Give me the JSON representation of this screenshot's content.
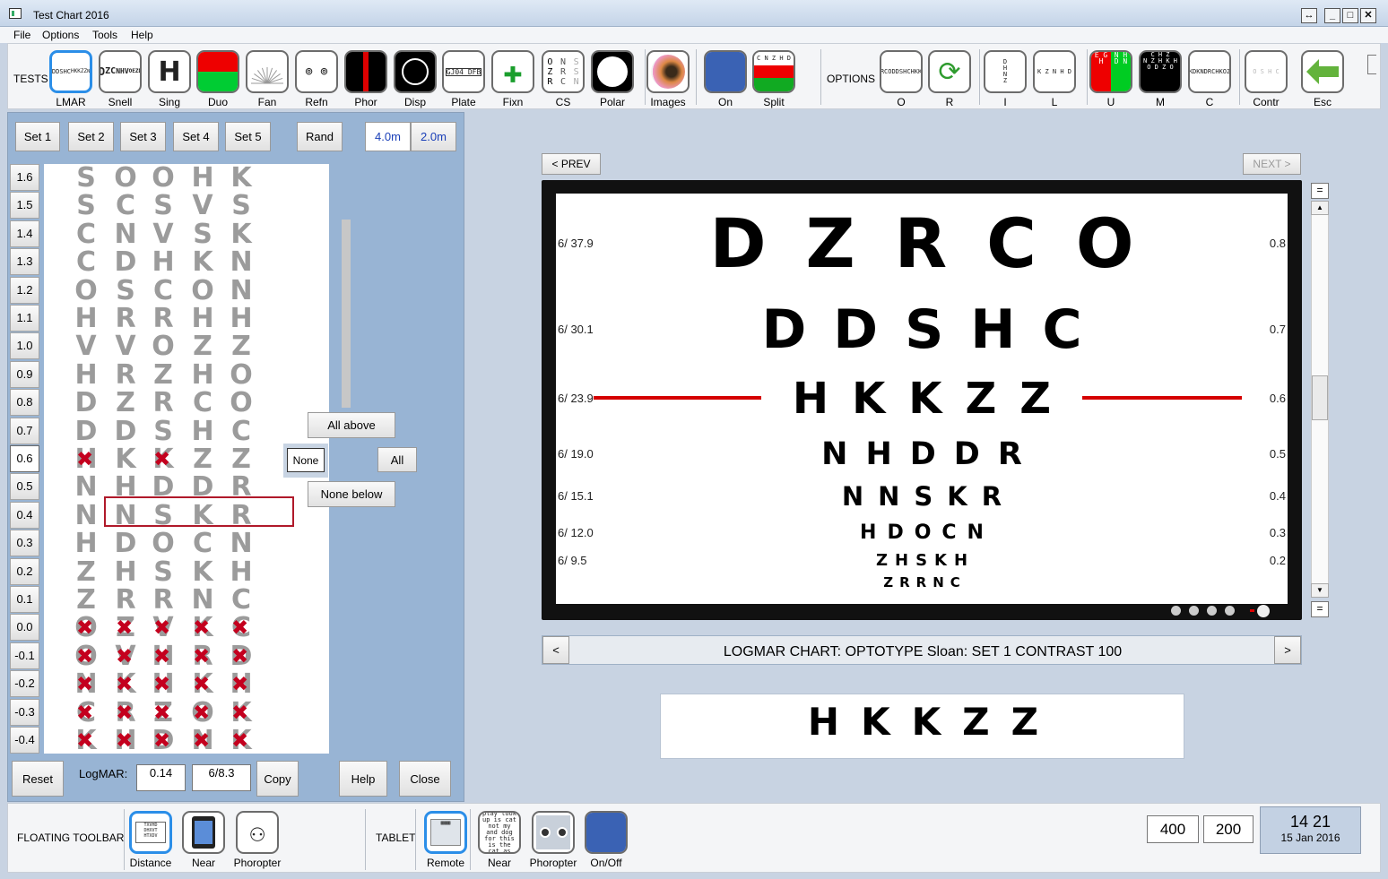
{
  "window": {
    "title": "Test Chart 2016"
  },
  "menu": [
    "File",
    "Options",
    "Tools",
    "Help"
  ],
  "toolbar": {
    "tests_label": "TESTS",
    "options_label": "OPTIONS",
    "tests": [
      {
        "id": "lmar",
        "label": "LMAR",
        "icon": "logmar-chart-icon",
        "selected": true
      },
      {
        "id": "snell",
        "label": "Snell",
        "icon": "snellen-chart-icon"
      },
      {
        "id": "sing",
        "label": "Sing",
        "icon": "single-letter-icon"
      },
      {
        "id": "duo",
        "label": "Duo",
        "icon": "duochrome-icon"
      },
      {
        "id": "fan",
        "label": "Fan",
        "icon": "fan-chart-icon"
      },
      {
        "id": "refn",
        "label": "Refn",
        "icon": "refraction-icon"
      },
      {
        "id": "phor",
        "label": "Phor",
        "icon": "phoria-icon"
      },
      {
        "id": "disp",
        "label": "Disp",
        "icon": "disparity-icon"
      },
      {
        "id": "plate",
        "label": "Plate",
        "icon": "plate-icon"
      },
      {
        "id": "fixn",
        "label": "Fixn",
        "icon": "fixation-cross-icon"
      },
      {
        "id": "cs",
        "label": "CS",
        "icon": "contrast-sensitivity-icon"
      },
      {
        "id": "polar",
        "label": "Polar",
        "icon": "polar-icon"
      },
      {
        "id": "images",
        "label": "Images",
        "icon": "eye-image-icon"
      },
      {
        "id": "on",
        "label": "On",
        "icon": "display-on-icon"
      },
      {
        "id": "split",
        "label": "Split",
        "icon": "split-icon"
      }
    ],
    "options": [
      {
        "id": "o",
        "label": "O",
        "icon": "optotype-icon"
      },
      {
        "id": "r",
        "label": "R",
        "icon": "rotate-icon"
      },
      {
        "id": "i",
        "label": "I",
        "icon": "vertical-letters-icon"
      },
      {
        "id": "l",
        "label": "L",
        "icon": "line-letters-icon"
      },
      {
        "id": "u",
        "label": "U",
        "icon": "red-green-chart-icon"
      },
      {
        "id": "m",
        "label": "M",
        "icon": "mirror-chart-icon"
      },
      {
        "id": "c",
        "label": "C",
        "icon": "chart-c-icon"
      },
      {
        "id": "contr",
        "label": "Contr",
        "icon": "contrast-icon"
      },
      {
        "id": "esc",
        "label": "Esc",
        "icon": "back-arrow-icon"
      }
    ],
    "icon_text": {
      "lmar": [
        "DZRCO",
        "DDSHC",
        "HKKZZ",
        "NHDDR",
        "NNSKR"
      ],
      "snell": [
        "D",
        "ZC",
        "NHV",
        "OEZD"
      ],
      "sing": "H",
      "plate": "GJ04 DFB",
      "cs": [
        "O Z R",
        "N R C",
        "S S N"
      ],
      "split": "C N Z H D",
      "o": [
        "DZRCO",
        "DDSHC",
        "HKKZZ"
      ],
      "i": "D H N Z",
      "l": "K Z N H D",
      "u": [
        "E G H",
        "N H D N"
      ],
      "m": [
        "C H Z",
        "N Z H K H",
        "O D Z O"
      ],
      "c": [
        "SVKDK",
        "NDRCH",
        "KOZCN"
      ],
      "contr": "O S H C"
    }
  },
  "panel": {
    "sets": [
      "Set 1",
      "Set 2",
      "Set 3",
      "Set 4",
      "Set 5"
    ],
    "rand": "Rand",
    "dist": [
      "4.0m",
      "2.0m"
    ],
    "rows": [
      {
        "v": "1.6",
        "l": "SOOHK"
      },
      {
        "v": "1.5",
        "l": "SCSVS"
      },
      {
        "v": "1.4",
        "l": "CNVSK"
      },
      {
        "v": "1.3",
        "l": "CDHKN"
      },
      {
        "v": "1.2",
        "l": "OSCON"
      },
      {
        "v": "1.1",
        "l": "HRRHH"
      },
      {
        "v": "1.0",
        "l": "VVOZZ"
      },
      {
        "v": "0.9",
        "l": "HRZHO"
      },
      {
        "v": "0.8",
        "l": "DZRCO"
      },
      {
        "v": "0.7",
        "l": "DDSHC"
      },
      {
        "v": "0.6",
        "l": "HKKZZ",
        "x": [
          0,
          2
        ]
      },
      {
        "v": "0.5",
        "l": "NHDDR"
      },
      {
        "v": "0.4",
        "l": "NNSKR"
      },
      {
        "v": "0.3",
        "l": "HDOCN"
      },
      {
        "v": "0.2",
        "l": "ZHSKH"
      },
      {
        "v": "0.1",
        "l": "ZRRNC"
      },
      {
        "v": "0.0",
        "l": "OZVKC",
        "x": [
          0,
          1,
          2,
          3,
          4
        ]
      },
      {
        "v": "-0.1",
        "l": "OVHRD",
        "x": [
          0,
          1,
          2,
          3,
          4
        ]
      },
      {
        "v": "-0.2",
        "l": "NKHKH",
        "x": [
          0,
          1,
          2,
          3,
          4
        ]
      },
      {
        "v": "-0.3",
        "l": "CRZOK",
        "x": [
          0,
          1,
          2,
          3,
          4
        ]
      },
      {
        "v": "-0.4",
        "l": "KHDNK",
        "x": [
          0,
          1,
          2,
          3,
          4
        ]
      }
    ],
    "all_above": "All above",
    "none": "None",
    "all": "All",
    "none_below": "None below",
    "reset": "Reset",
    "logmar_label": "LogMAR:",
    "logmar_value": "0.14",
    "snellen_value": "6/8.3",
    "copy": "Copy",
    "help": "Help",
    "close": "Close"
  },
  "chart": {
    "prev": "< PREV",
    "next": "NEXT >",
    "rows": [
      {
        "left": "6/ 37.9",
        "right": "0.8",
        "letters": "DZRCO"
      },
      {
        "left": "6/ 30.1",
        "right": "0.7",
        "letters": "DDSHC"
      },
      {
        "left": "6/ 23.9",
        "right": "0.6",
        "letters": "HKKZZ"
      },
      {
        "left": "6/ 19.0",
        "right": "0.5",
        "letters": "NHDDR"
      },
      {
        "left": "6/ 15.1",
        "right": "0.4",
        "letters": "NNSKR"
      },
      {
        "left": "6/ 12.0",
        "right": "0.3",
        "letters": "HDOCN"
      },
      {
        "left": "6/ 9.5",
        "right": "0.2",
        "letters": "ZHSKH"
      },
      {
        "left": "",
        "right": "",
        "letters": "ZRRNC"
      }
    ],
    "status": "LOGMAR CHART:  OPTOTYPE Sloan:   SET 1  CONTRAST  100",
    "focus_line": "HKKZZ"
  },
  "bottom": {
    "floating_label": "FLOATING TOOLBAR",
    "tablet_label": "TABLET",
    "floating": [
      {
        "label": "Distance",
        "icon": "distance-chart-icon",
        "selected": true
      },
      {
        "label": "Near",
        "icon": "tablet-icon"
      },
      {
        "label": "Phoropter",
        "icon": "phoropter-icon"
      }
    ],
    "tablet": [
      {
        "label": "Remote",
        "icon": "remote-icon",
        "selected": true
      },
      {
        "label": "Near",
        "icon": "near-text-icon",
        "text": "see the play look up is cat not my and dog for this is the cat as well"
      },
      {
        "label": "Phoropter",
        "icon": "phoropter-device-icon"
      },
      {
        "label": "On/Off",
        "icon": "on-off-icon"
      }
    ],
    "field1": "400",
    "field2": "200",
    "time": "14 21",
    "date": "15 Jan 2016"
  }
}
